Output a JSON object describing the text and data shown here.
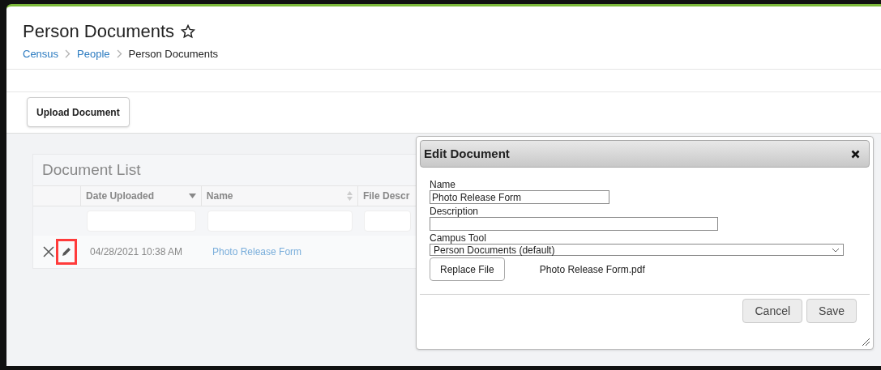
{
  "page": {
    "title": "Person Documents",
    "favorite": false
  },
  "breadcrumb": [
    {
      "label": "Census",
      "link": true
    },
    {
      "label": "People",
      "link": true
    },
    {
      "label": "Person Documents",
      "link": false
    }
  ],
  "toolbar": {
    "buttons": [
      "Upload Document"
    ]
  },
  "document_list": {
    "title": "Document List",
    "columns": [
      {
        "label": "Date Uploaded",
        "sorted": true
      },
      {
        "label": "Name",
        "sorted": false
      },
      {
        "label": "File Descr"
      }
    ],
    "rows": [
      {
        "date": "04/28/2021 10:38 AM",
        "name": "Photo Release Form",
        "edit_highlighted": true
      }
    ]
  },
  "dialog": {
    "title": "Edit Document",
    "fields": [
      {
        "label": "Name",
        "value": "Photo Release Form",
        "kind": "short"
      },
      {
        "label": "Description",
        "kind": "medium"
      },
      {
        "label": "Campus Tool",
        "value": "Person Documents (default)",
        "kind": "select"
      }
    ],
    "replace_button": "Replace File",
    "file_name": "Photo Release Form.pdf",
    "buttons": [
      "Cancel",
      "Save"
    ]
  }
}
